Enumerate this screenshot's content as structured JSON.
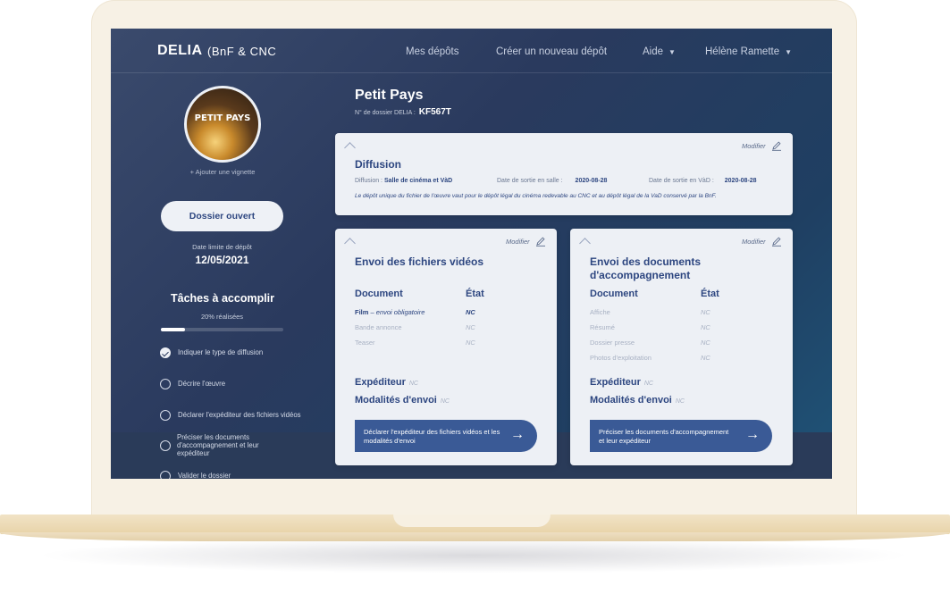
{
  "nav": {
    "brand": "DELIA",
    "brand_sub": "(BnF & CNC",
    "links": [
      "Mes dépôts",
      "Créer un nouveau dépôt",
      "Aide",
      "Hélène Ramette"
    ]
  },
  "sidebar": {
    "poster_title": "PETIT PAYS",
    "add_thumbnail": "+ Ajouter une vignette",
    "status_button": "Dossier ouvert",
    "deadline_label": "Date limite de dépôt",
    "deadline": "12/05/2021",
    "tasks_title": "Tâches à accomplir",
    "tasks_progress_label": "20% réalisées",
    "tasks_progress": 0.2,
    "tasks": [
      {
        "label": "Indiquer le type de diffusion",
        "done": true
      },
      {
        "label": "Décrire l'œuvre",
        "done": false
      },
      {
        "label": "Déclarer l'expéditeur des fichiers vidéos",
        "done": false
      },
      {
        "label": "Préciser les documents d'accompagnement et leur expéditeur",
        "done": false
      },
      {
        "label": "Valider le dossier",
        "done": false
      }
    ]
  },
  "header": {
    "title": "Petit Pays",
    "dossier_label": "N° de dossier DELIA :",
    "dossier_number": "KF567T"
  },
  "diffusion": {
    "modify": "Modifier",
    "title": "Diffusion",
    "diffusion_label": "Diffusion :",
    "diffusion_value": "Salle de cinéma et VàD",
    "release_cinema_label": "Date de sortie en salle :",
    "release_cinema": "2020-08-28",
    "release_vad_label": "Date de sortie en VàD :",
    "release_vad": "2020-08-28",
    "note": "Le dépôt unique du fichier de l'œuvre vaut pour le dépôt légal du cinéma redevable au CNC et au dépôt légal de la VaD conservé par la BnF."
  },
  "videos": {
    "modify": "Modifier",
    "title": "Envoi des fichiers vidéos",
    "col_document": "Document",
    "col_state": "État",
    "rows": [
      {
        "doc": "Film",
        "note": "– envoi obligatoire",
        "state": "NC"
      },
      {
        "doc": "Bande annonce",
        "note": "",
        "state": "NC"
      },
      {
        "doc": "Teaser",
        "note": "",
        "state": "NC"
      }
    ],
    "sender_label": "Expéditeur",
    "sender_value": "NC",
    "modalities_label": "Modalités d'envoi",
    "modalities_value": "NC",
    "cta": "Déclarer l'expéditeur des fichiers vidéos et les modalités d'envoi"
  },
  "documents": {
    "modify": "Modifier",
    "title": "Envoi des documents d'accompagnement",
    "col_document": "Document",
    "col_state": "État",
    "rows": [
      {
        "doc": "Affiche",
        "state": "NC"
      },
      {
        "doc": "Résumé",
        "state": "NC"
      },
      {
        "doc": "Dossier presse",
        "state": "NC"
      },
      {
        "doc": "Photos d'exploitation",
        "state": "NC"
      }
    ],
    "sender_label": "Expéditeur",
    "sender_value": "NC",
    "modalities_label": "Modalités d'envoi",
    "modalities_value": "NC",
    "cta": "Préciser les documents d'accompagnement et leur expéditeur"
  },
  "icons": {
    "arrow": "arrow-right-icon",
    "pencil": "pencil-icon",
    "chevron": "chevron-up-icon",
    "check": "check-circle-icon"
  },
  "colors": {
    "accent": "#2d4680",
    "cta": "#3a5a96",
    "card": "#edf0f5"
  }
}
